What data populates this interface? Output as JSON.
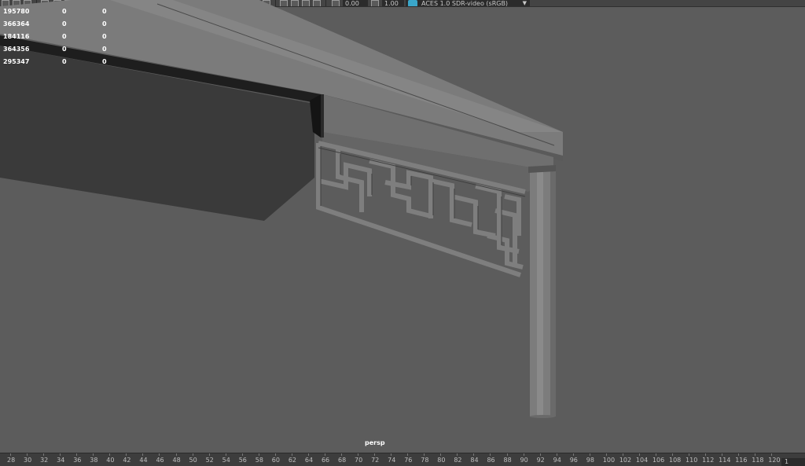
{
  "toolbar": {
    "exposure_value": "0.00",
    "gamma_value": "1.00",
    "color_space_label": "ACES 1.0 SDR-video (sRGB)"
  },
  "hud": {
    "rows": [
      {
        "c0": "195780",
        "c1": "0",
        "c2": "0"
      },
      {
        "c0": "366364",
        "c1": "0",
        "c2": "0"
      },
      {
        "c0": "184116",
        "c1": "0",
        "c2": "0"
      },
      {
        "c0": "364356",
        "c1": "0",
        "c2": "0"
      },
      {
        "c0": "295347",
        "c1": "0",
        "c2": "0"
      }
    ]
  },
  "viewport": {
    "camera_label": "persp"
  },
  "timeslider": {
    "ticks": [
      "28",
      "30",
      "32",
      "34",
      "36",
      "38",
      "40",
      "42",
      "44",
      "46",
      "48",
      "50",
      "52",
      "54",
      "56",
      "58",
      "60",
      "62",
      "64",
      "66",
      "68",
      "70",
      "72",
      "74",
      "76",
      "78",
      "80",
      "82",
      "84",
      "86",
      "88",
      "90",
      "92",
      "94",
      "96",
      "98",
      "100",
      "102",
      "104",
      "106",
      "108",
      "110",
      "112",
      "114",
      "116",
      "118",
      "120"
    ],
    "current_frame": "1"
  },
  "colors": {
    "background": "#5c5c5c",
    "accent": "#3aa6c9"
  },
  "icons": [
    "select-icon",
    "move-icon",
    "paint-icon",
    "grid-icon",
    "camera-icon",
    "shading-icon",
    "wireframe-icon",
    "lighting-icon",
    "shadow-icon",
    "isolate-icon",
    "xray-icon",
    "exposure-icon",
    "gamma-icon",
    "color-space-icon"
  ]
}
